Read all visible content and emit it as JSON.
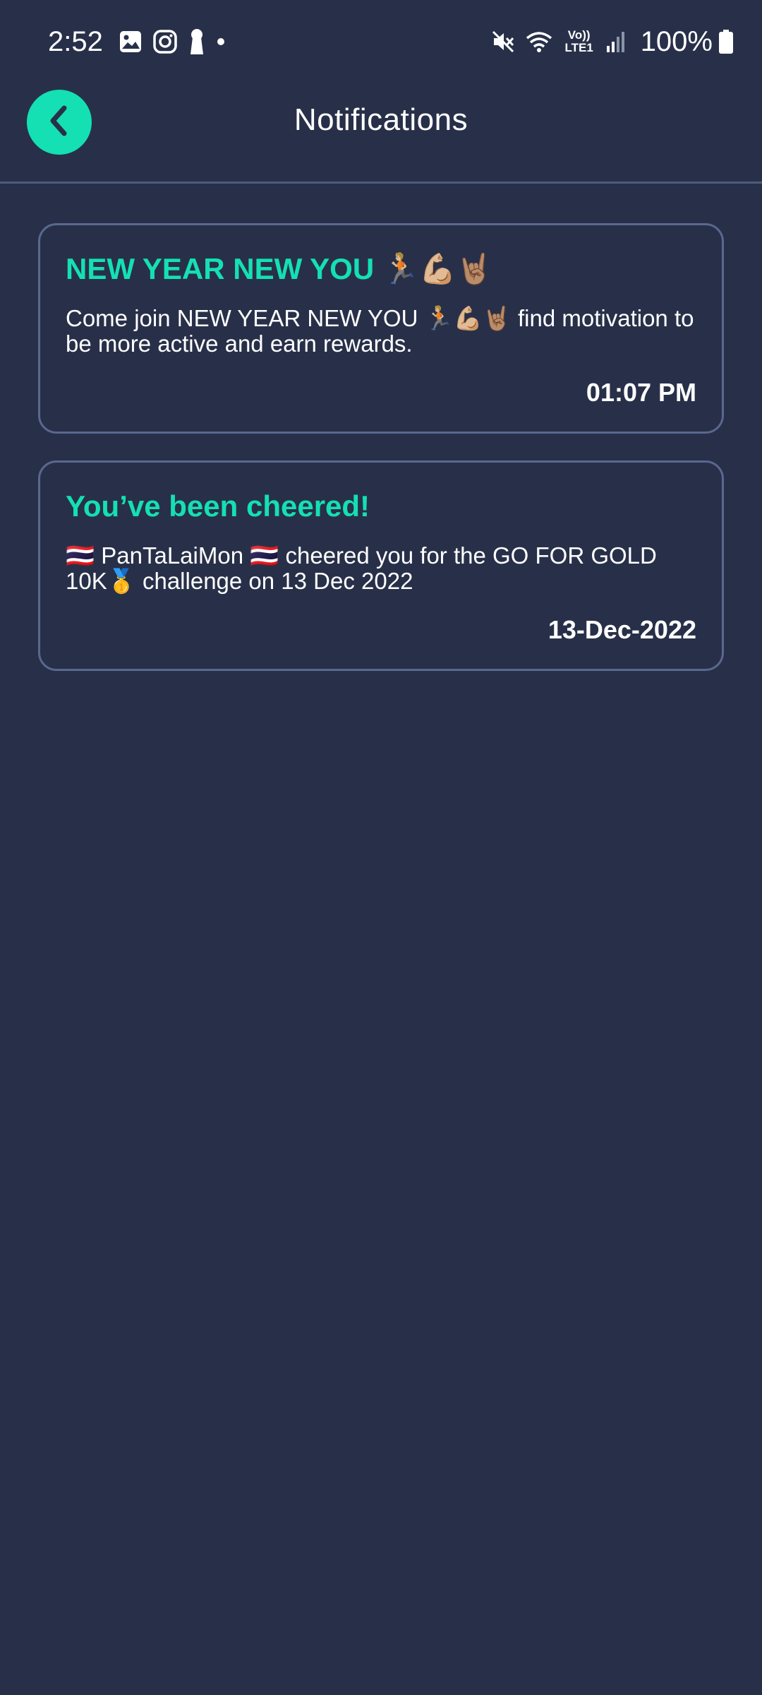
{
  "status_bar": {
    "time": "2:52",
    "battery_percent": "100%",
    "network_label": "Vo)) LTE1",
    "left_icons": [
      "gallery-icon",
      "instagram-icon",
      "keyhole-icon",
      "dot-icon"
    ],
    "right_icons": [
      "mute-icon",
      "wifi-icon",
      "lte-icon",
      "signal-icon",
      "battery-icon"
    ]
  },
  "header": {
    "title": "Notifications",
    "back_icon": "chevron-left-icon",
    "accent_color": "#14e0b3"
  },
  "notifications": [
    {
      "title": "NEW YEAR NEW YOU 🏃🏼💪🏼🤘🏽",
      "body": "Come join NEW YEAR NEW YOU 🏃🏼💪🏼🤘🏽 find motivation to be more active and earn rewards.",
      "time": "01:07 PM"
    },
    {
      "title": "You’ve been cheered!",
      "body": " 🇹🇭 PanTaLaiMon 🇹🇭 cheered you for the GO FOR GOLD 10K🥇 challenge on 13 Dec 2022",
      "time": "13-Dec-2022"
    }
  ],
  "colors": {
    "background": "#283049",
    "card_border": "#5a6890",
    "accent": "#14e0b3"
  }
}
